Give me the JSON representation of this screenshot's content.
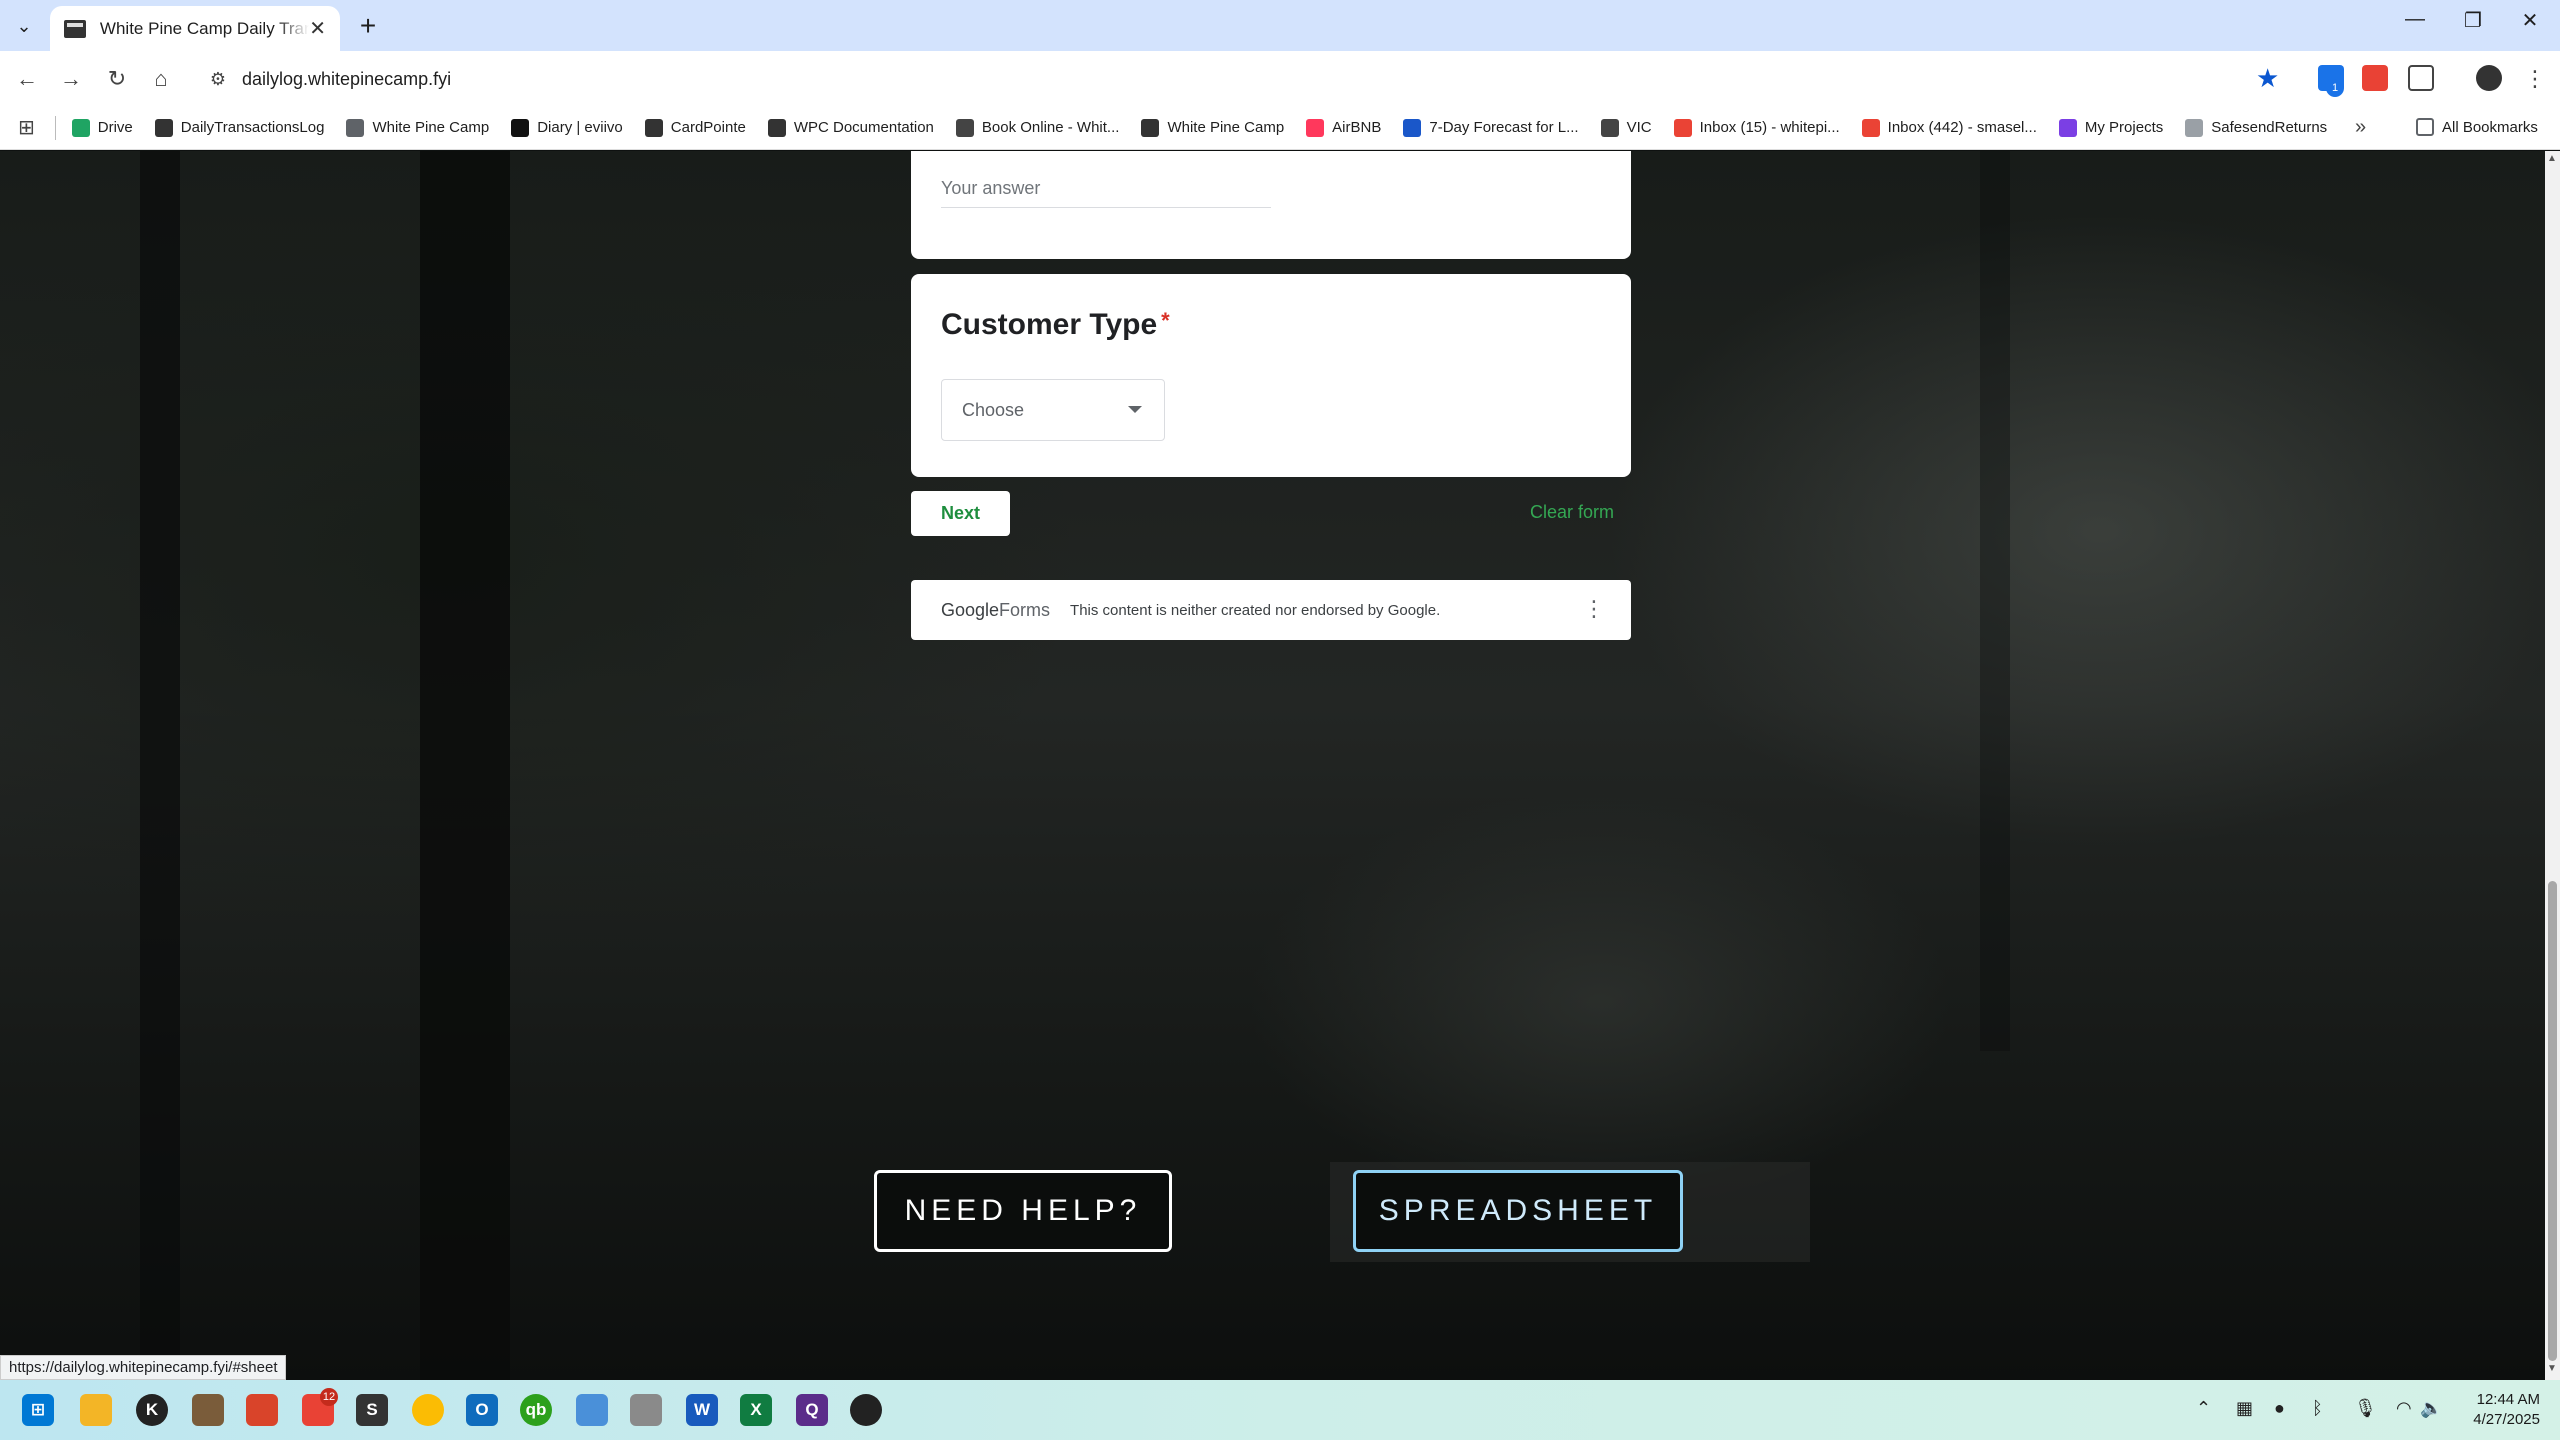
{
  "browser": {
    "tab_title": "White Pine Camp Daily Transactions",
    "url": "dailylog.whitepinecamp.fyi",
    "extension_badge": "1",
    "bookmarks": [
      {
        "label": "Drive",
        "icon": "drive-icon",
        "color": "#1fa463"
      },
      {
        "label": "DailyTransactionsLog",
        "icon": "site-icon",
        "color": "#333333"
      },
      {
        "label": "White Pine Camp",
        "icon": "folder-icon",
        "color": "#5f6368"
      },
      {
        "label": "Diary | eviivo",
        "icon": "site-icon",
        "color": "#111111"
      },
      {
        "label": "CardPointe",
        "icon": "card-icon",
        "color": "#333333"
      },
      {
        "label": "WPC Documentation",
        "icon": "site-icon",
        "color": "#333333"
      },
      {
        "label": "Book Online - Whit...",
        "icon": "globe-icon",
        "color": "#444444"
      },
      {
        "label": "White Pine Camp",
        "icon": "site-icon",
        "color": "#333333"
      },
      {
        "label": "AirBNB",
        "icon": "airbnb-icon",
        "color": "#ff385c"
      },
      {
        "label": "7-Day Forecast for L...",
        "icon": "weather-icon",
        "color": "#1a57c9"
      },
      {
        "label": "VIC",
        "icon": "globe-icon",
        "color": "#444444"
      },
      {
        "label": "Inbox (15) - whitepi...",
        "icon": "gmail-icon",
        "color": "#ea4335"
      },
      {
        "label": "Inbox (442) - smasel...",
        "icon": "gmail-icon",
        "color": "#ea4335"
      },
      {
        "label": "My Projects",
        "icon": "projects-icon",
        "color": "#7b3fe4"
      },
      {
        "label": "SafesendReturns",
        "icon": "safesend-icon",
        "color": "#9aa0a6"
      }
    ],
    "all_bookmarks": "All Bookmarks",
    "status_url": "https://dailylog.whitepinecamp.fyi/#sheet"
  },
  "form": {
    "answer_placeholder": "Your answer",
    "question_title": "Customer Type",
    "required_mark": "*",
    "dropdown_value": "Choose",
    "next_label": "Next",
    "clear_label": "Clear form",
    "footer_logo_google": "Google",
    "footer_logo_forms": "Forms",
    "footer_disclaimer": "This content is neither created nor endorsed by Google."
  },
  "page_buttons": {
    "help": "NEED HELP?",
    "spreadsheet": "SPREADSHEET"
  },
  "taskbar": {
    "badge_count": "12",
    "time": "12:44 AM",
    "date": "4/27/2025"
  },
  "colors": {
    "accent_green": "#1e8e3e",
    "required_red": "#d93025",
    "spreadsheet_border": "#8fd2f5",
    "star_blue": "#0b57d0"
  }
}
